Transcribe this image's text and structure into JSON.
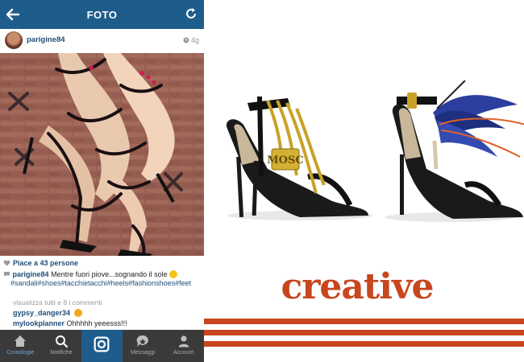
{
  "header": {
    "title": "FOTO"
  },
  "post": {
    "username": "parigine84",
    "age": "4g",
    "likes": "Piace a 43 persone",
    "caption_user": "parigine84",
    "caption_text": "Mentre fuori piove...sognando il sole",
    "caption_tags": "#sandali#shoes#tacchietacchi#heels#fashionshoes#feet",
    "view_all": "visualizza tutti e 8 i commenti",
    "comments": [
      {
        "user": "gypsy_danger34",
        "text": ""
      },
      {
        "user": "mylookplanner",
        "text": "Ohhhhh yeeesss!!!"
      }
    ]
  },
  "tabs": [
    {
      "label": "Cronologie",
      "icon": "home-icon"
    },
    {
      "label": "Notifiche",
      "icon": "search-icon"
    },
    {
      "label": "",
      "icon": "camera-icon"
    },
    {
      "label": "Messaggi",
      "icon": "chat-icon"
    },
    {
      "label": "Account",
      "icon": "account-icon"
    }
  ],
  "right": {
    "shoe_brand": "MOSC",
    "tagline": "creative"
  },
  "colors": {
    "header": "#1e5c8c",
    "tabbar": "#3a3a3a",
    "link": "#1f4e79",
    "accent": "#c8461e"
  }
}
